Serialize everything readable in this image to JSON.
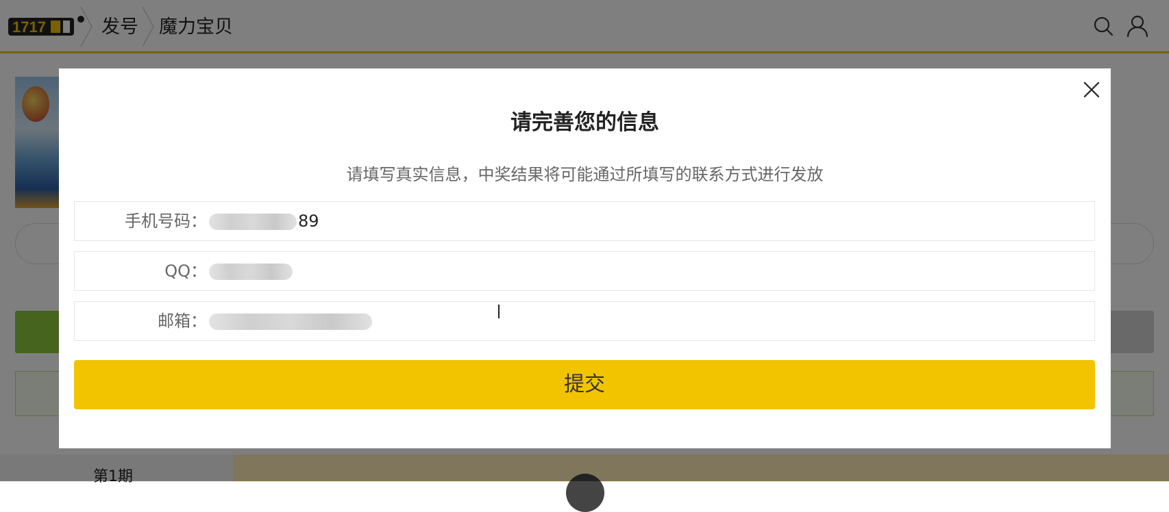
{
  "header": {
    "breadcrumbs": [
      "发号",
      "魔力宝贝"
    ],
    "accent_color": "#f2c300",
    "icons": [
      "search-icon",
      "user-icon"
    ]
  },
  "background": {
    "issue_label": "第1期"
  },
  "modal": {
    "title": "请完善您的信息",
    "subtitle": "请填写真实信息，中奖结果将可能通过所填写的联系方式进行发放",
    "fields": [
      {
        "label": "手机号码：",
        "value_suffix": "89"
      },
      {
        "label": "QQ：",
        "value_suffix": ""
      },
      {
        "label": "邮箱：",
        "value_suffix": ""
      }
    ],
    "submit_label": "提交",
    "submit_color": "#f2c400",
    "close_icon": "close-icon"
  }
}
